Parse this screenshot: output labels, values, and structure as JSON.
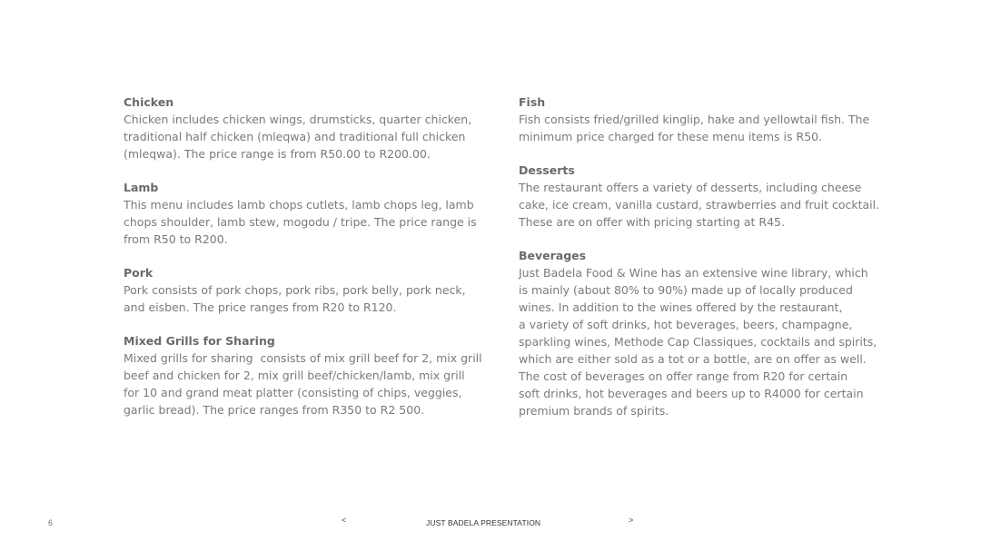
{
  "left_column": {
    "chicken": {
      "title": "Chicken",
      "lines": [
        "Chicken includes chicken wings, drumsticks, quarter chicken,",
        "traditional half chicken (mleqwa) and traditional full chicken",
        "(mleqwa). The price range is from R50.00 to R200.00."
      ]
    },
    "lamb": {
      "title": "Lamb",
      "lines": [
        "This menu includes lamb chops cutlets, lamb chops leg, lamb",
        "chops shoulder, lamb stew, mogodu / tripe. The price range is",
        "from R50 to R200."
      ]
    },
    "pork": {
      "title": "Pork",
      "lines": [
        "Pork consists of pork chops, pork ribs, pork belly, pork neck,",
        "and eisben. The price ranges from R20 to R120."
      ]
    },
    "mixed_grills": {
      "title": "Mixed Grills for Sharing",
      "lines": [
        "Mixed grills for sharing  consists of mix grill beef for 2, mix grill",
        "beef and chicken for 2, mix grill beef/chicken/lamb, mix grill",
        "for 10 and grand meat platter (consisting of chips, veggies,",
        "garlic bread). The price ranges from R350 to R2 500."
      ]
    }
  },
  "right_column": {
    "fish": {
      "title": "Fish",
      "lines": [
        "Fish consists fried/grilled kinglip, hake and yellowtail fish. The",
        "minimum price charged for these menu items is R50."
      ]
    },
    "desserts": {
      "title": "Desserts",
      "lines": [
        "The restaurant offers a variety of desserts, including cheese",
        "cake, ice cream, vanilla custard, strawberries and fruit cocktail.",
        "These are on offer with pricing starting at R45."
      ]
    },
    "beverages": {
      "title": "Beverages",
      "lines": [
        "Just Badela Food & Wine has an extensive wine library, which",
        "is mainly (about 80% to 90%) made up of locally produced",
        "wines. In addition to the wines offered by the restaurant,",
        "a variety of soft drinks, hot beverages, beers, champagne,",
        "sparkling wines, Methode Cap Classiques, cocktails and spirits,",
        "which are either sold as a tot or a bottle, are on offer as well.",
        "The cost of beverages on offer range from R20 for certain",
        "soft drinks, hot beverages and beers up to R4000 for certain",
        "premium brands of spirits."
      ]
    }
  },
  "footer": {
    "page_number": "6",
    "prev_label": "<",
    "title": "JUST BADELA PRESENTATION",
    "next_label": ">"
  }
}
